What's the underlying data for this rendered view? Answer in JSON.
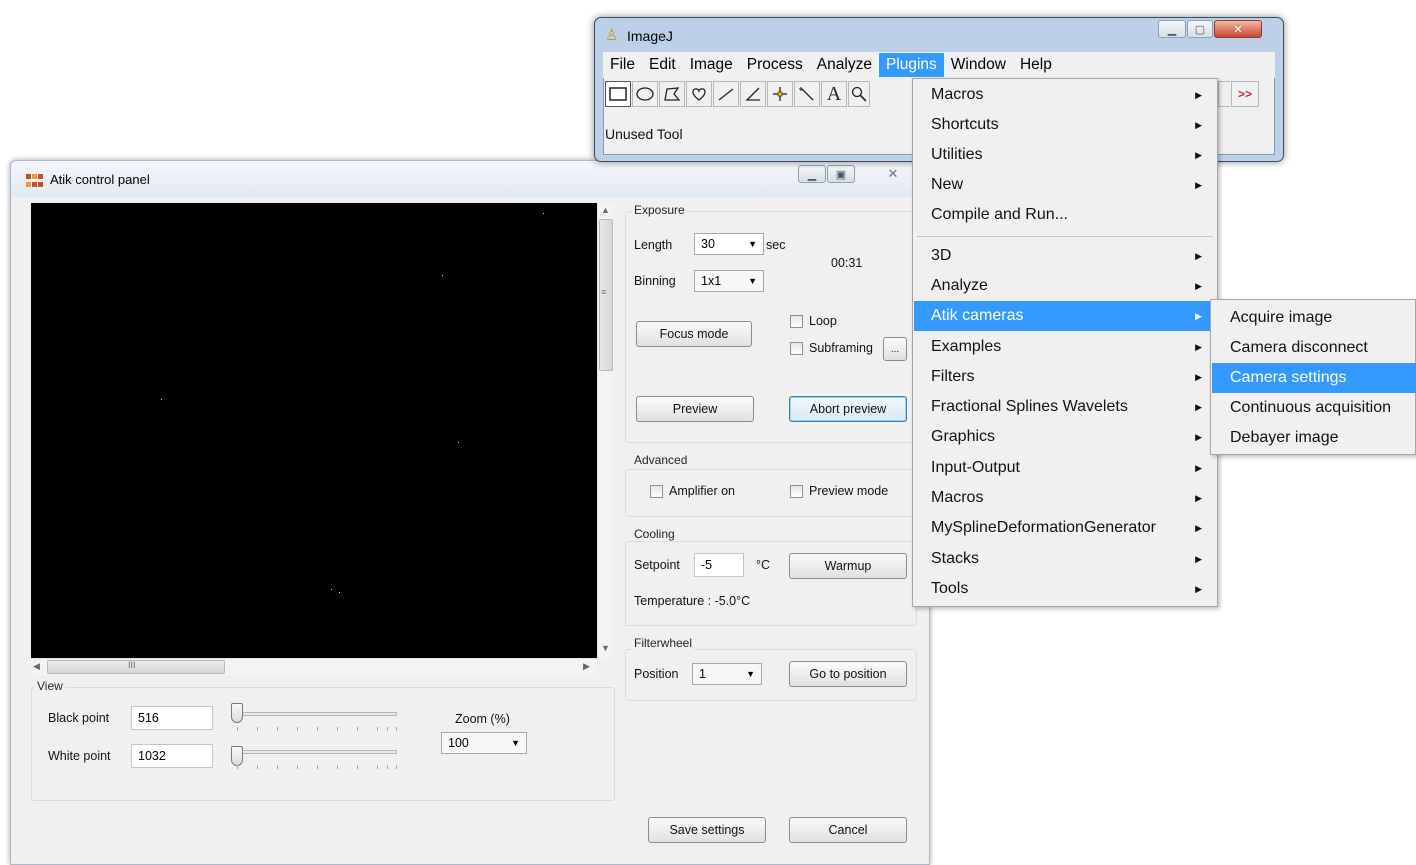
{
  "atik_window": {
    "title": "Atik control panel",
    "exposure": {
      "group_label": "Exposure",
      "length_label": "Length",
      "length_value": "30",
      "length_unit": "sec",
      "elapsed": "00:31",
      "binning_label": "Binning",
      "binning_value": "1x1",
      "focus_mode_label": "Focus mode",
      "loop_label": "Loop",
      "subframing_label": "Subframing",
      "subframing_button_label": "...",
      "preview_label": "Preview",
      "abort_preview_label": "Abort preview"
    },
    "advanced": {
      "group_label": "Advanced",
      "amplifier_label": "Amplifier on",
      "preview_mode_label": "Preview mode"
    },
    "cooling": {
      "group_label": "Cooling",
      "setpoint_label": "Setpoint",
      "setpoint_value": "-5",
      "unit": "°C",
      "warmup_label": "Warmup",
      "temperature_text": "Temperature : -5.0°C"
    },
    "filterwheel": {
      "group_label": "Filterwheel",
      "position_label": "Position",
      "position_value": "1",
      "go_label": "Go to position"
    },
    "view": {
      "group_label": "View",
      "black_point_label": "Black point",
      "black_point_value": "516",
      "white_point_label": "White point",
      "white_point_value": "1032",
      "zoom_label": "Zoom (%)",
      "zoom_value": "100"
    },
    "scroll_glyph": "III",
    "save_settings_label": "Save settings",
    "cancel_label": "Cancel"
  },
  "imagej_window": {
    "title": "ImageJ",
    "menus": [
      "File",
      "Edit",
      "Image",
      "Process",
      "Analyze",
      "Plugins",
      "Window",
      "Help"
    ],
    "status_text": "Unused Tool",
    "more_tools_label": ">>",
    "text_tool_glyph": "A"
  },
  "plugins_menu": {
    "items": [
      {
        "label": "Macros"
      },
      {
        "label": "Shortcuts"
      },
      {
        "label": "Utilities"
      },
      {
        "label": "New"
      },
      {
        "label": "Compile and Run..."
      },
      {
        "label": "3D"
      },
      {
        "label": "Analyze"
      },
      {
        "label": "Atik cameras"
      },
      {
        "label": "Examples"
      },
      {
        "label": "Filters"
      },
      {
        "label": "Fractional Splines Wavelets"
      },
      {
        "label": "Graphics"
      },
      {
        "label": "Input-Output"
      },
      {
        "label": "Macros"
      },
      {
        "label": "MySplineDeformationGenerator"
      },
      {
        "label": "Stacks"
      },
      {
        "label": "Tools"
      }
    ]
  },
  "atik_submenu": {
    "items": [
      {
        "label": "Acquire image"
      },
      {
        "label": "Camera disconnect"
      },
      {
        "label": "Camera settings"
      },
      {
        "label": "Continuous acquisition"
      },
      {
        "label": "Debayer image"
      }
    ]
  },
  "colors": {
    "highlight": "#3399ff",
    "window_bg": "#f0f0f0",
    "aero_frame": "#bcd0e8"
  }
}
